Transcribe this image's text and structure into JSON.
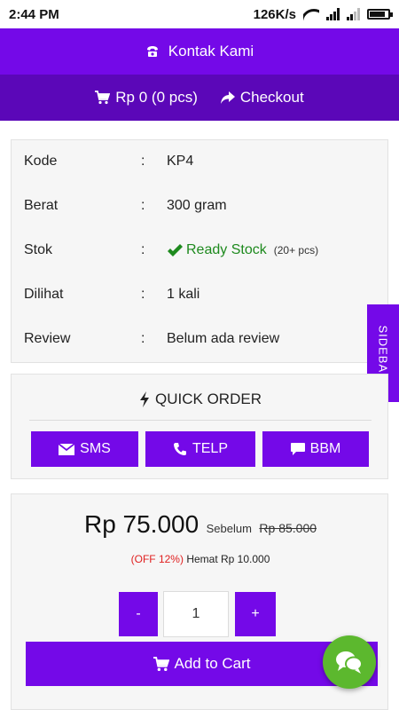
{
  "status_bar": {
    "time": "2:44 PM",
    "network_speed": "126K/s",
    "icons": [
      "wifi-icon",
      "signal-icon",
      "signal-icon",
      "battery-icon"
    ]
  },
  "header": {
    "contact_label": "Kontak Kami",
    "contact_icon": "phone-icon",
    "cart_label": "Rp 0 (0 pcs)",
    "cart_icon": "cart-icon",
    "checkout_label": "Checkout",
    "checkout_icon": "share-arrow-icon"
  },
  "product_info": {
    "separator": ":",
    "rows": [
      {
        "label": "Kode",
        "value": "KP4"
      },
      {
        "label": "Berat",
        "value": "300 gram"
      },
      {
        "label": "Stok",
        "value": "Ready Stock",
        "extra": "(20+ pcs)",
        "icon": "check-icon"
      },
      {
        "label": "Dilihat",
        "value": "1 kali"
      },
      {
        "label": "Review",
        "value": "Belum ada review"
      }
    ]
  },
  "sidebar_tab": {
    "label": "SIDEBAR"
  },
  "quick_order": {
    "title": "QUICK ORDER",
    "title_icon": "bolt-icon",
    "buttons": [
      {
        "label": "SMS",
        "icon": "envelope-icon"
      },
      {
        "label": "TELP",
        "icon": "phone-icon"
      },
      {
        "label": "BBM",
        "icon": "chat-bubble-icon"
      }
    ]
  },
  "pricing": {
    "price": "Rp 75.000",
    "before_label": "Sebelum",
    "old_price": "Rp 85.000",
    "discount": "(OFF 12%)",
    "saving": "Hemat Rp 10.000"
  },
  "quantity": {
    "minus_label": "-",
    "value": "1",
    "plus_label": "+"
  },
  "add_to_cart": {
    "label": "Add to Cart",
    "icon": "cart-icon"
  },
  "chat_fab": {
    "icon": "chat-bubbles-icon"
  },
  "colors": {
    "primary": "#7409e8",
    "primary_dark": "#5b07b8",
    "stock_green": "#1e8a1e",
    "discount_red": "#e02020",
    "chat_green": "#5cb82e",
    "panel_bg": "#f6f6f6"
  }
}
